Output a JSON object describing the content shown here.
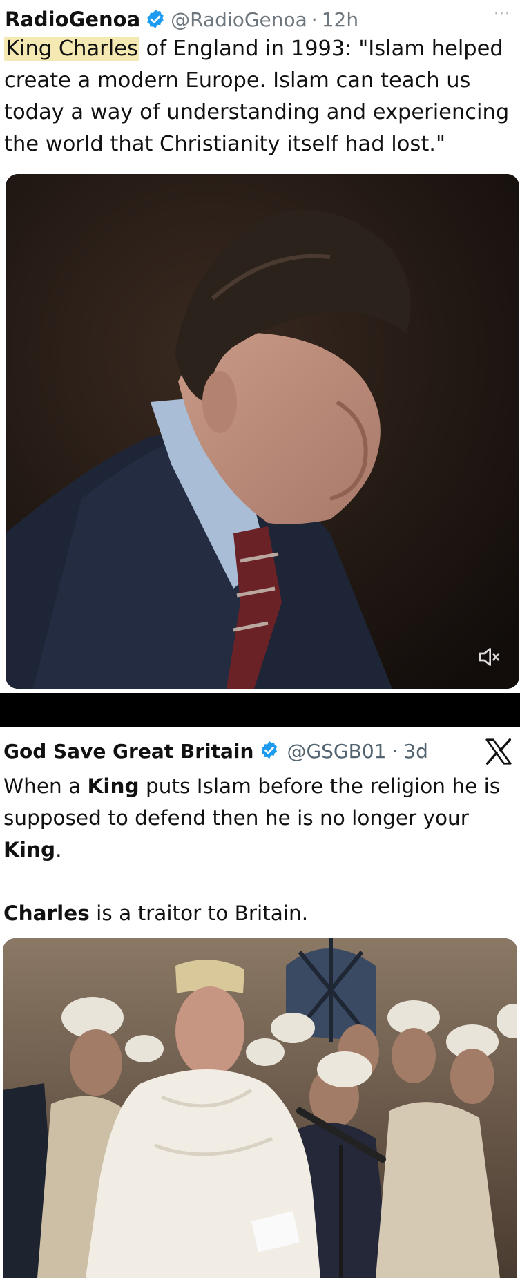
{
  "post1": {
    "author_name": "RadioGenoa",
    "handle": "@RadioGenoa",
    "separator": "·",
    "time": "12h",
    "more_label": "···",
    "text_highlight": "King Charles",
    "text_rest": " of England in 1993: \"Islam helped create a modern Europe. Islam can teach us today a way of understanding and experiencing the world that Christianity itself had lost.\"",
    "media": {
      "type": "video",
      "icon": "mute-icon",
      "muted": true
    }
  },
  "post2": {
    "author_name": "God Save Great Britain",
    "handle": "@GSGB01",
    "separator": "·",
    "time": "3d",
    "logo_icon": "x-logo-icon",
    "text": {
      "p1_a": "When a ",
      "p1_b": "King",
      "p1_c": " puts Islam before the religion he is supposed to defend then he is no longer your ",
      "p1_d": "King",
      "p1_e": ".",
      "p2_a": "Charles",
      "p2_b": " is a traitor to Britain."
    },
    "media": {
      "type": "photo"
    }
  },
  "colors": {
    "verified_blue": "#1d9bf0",
    "highlight": "#f5e9b3",
    "muted_text": "#6e767d",
    "separator_band": "#000000"
  }
}
